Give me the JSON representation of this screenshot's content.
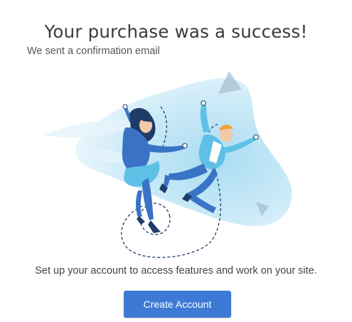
{
  "dialog": {
    "title": "Your purchase was a success!",
    "subtitle": "We sent a confirmation email",
    "message": "Set up your account to access features and work on your site.",
    "create_account_label": "Create Account",
    "illustration_icon": "celebrating-people-illustration"
  },
  "colors": {
    "accent": "#3d7ad6",
    "title_text": "#3b3b3b",
    "body_text": "#444444",
    "blob_light": "#d8eef8",
    "blob_mid": "#b8e0f2",
    "figure_dark_blue": "#3a73c6",
    "figure_light_blue": "#5fc0e6"
  }
}
